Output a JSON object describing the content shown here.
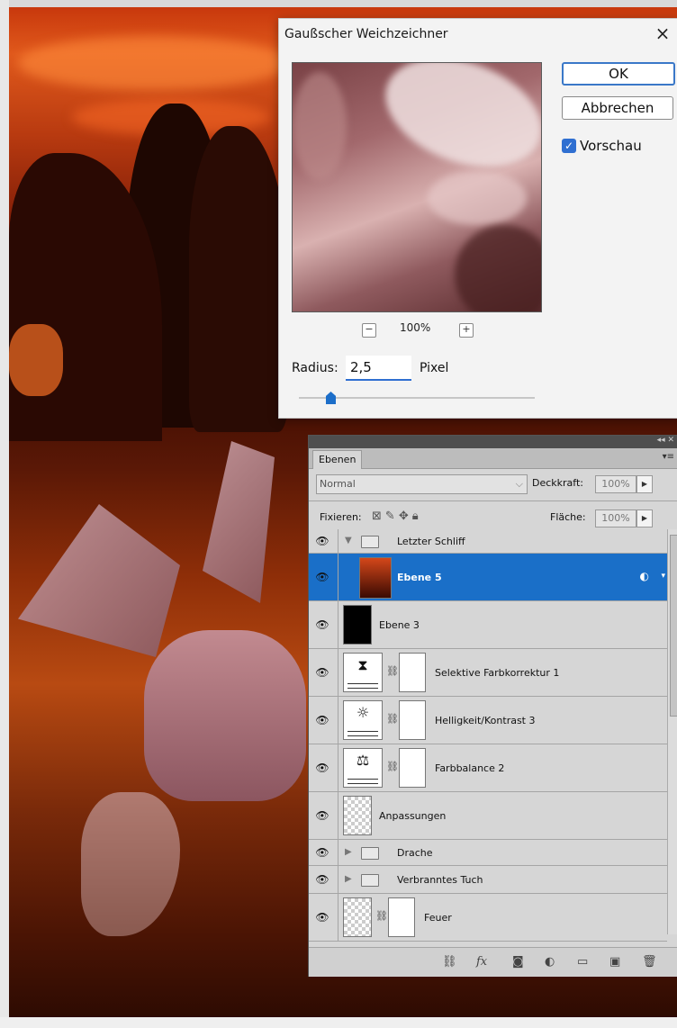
{
  "dialog": {
    "title": "Gaußscher Weichzeichner",
    "close_glyph": "×",
    "ok_label": "OK",
    "cancel_label": "Abbrechen",
    "preview_label": "Vorschau",
    "preview_checked": true,
    "zoom_minus": "−",
    "zoom_plus": "+",
    "zoom_value": "100%",
    "radius_label": "Radius:",
    "radius_value": "2,5",
    "radius_unit": "Pixel",
    "accent_color": "#2f6fd1"
  },
  "layers_panel": {
    "tab_label": "Ebenen",
    "blend_mode": "Normal",
    "opacity_label": "Deckkraft:",
    "opacity_value": "100%",
    "lock_label": "Fixieren:",
    "fill_label": "Fläche:",
    "fill_value": "100%",
    "selection_color": "#1a6fc8",
    "layers": [
      {
        "name": "Letzter Schliff",
        "kind": "group",
        "expanded": true
      },
      {
        "name": "Ebene 5",
        "kind": "smart-object",
        "selected": true
      },
      {
        "name": "Ebene 3",
        "kind": "pixel"
      },
      {
        "name": "Selektive Farbkorrektur 1",
        "kind": "adjustment",
        "icon": "selective-color-icon"
      },
      {
        "name": "Helligkeit/Kontrast 3",
        "kind": "adjustment",
        "icon": "brightness-contrast-icon"
      },
      {
        "name": "Farbbalance 2",
        "kind": "adjustment",
        "icon": "color-balance-icon"
      },
      {
        "name": "Anpassungen",
        "kind": "pixel"
      },
      {
        "name": "Drache",
        "kind": "group",
        "expanded": false
      },
      {
        "name": "Verbranntes Tuch",
        "kind": "group",
        "expanded": false
      },
      {
        "name": "Feuer",
        "kind": "masked-pixel"
      }
    ],
    "footer_icons": [
      "link-layers-icon",
      "fx-icon",
      "add-mask-icon",
      "adjustment-layer-icon",
      "new-group-icon",
      "new-layer-icon",
      "trash-icon"
    ]
  }
}
